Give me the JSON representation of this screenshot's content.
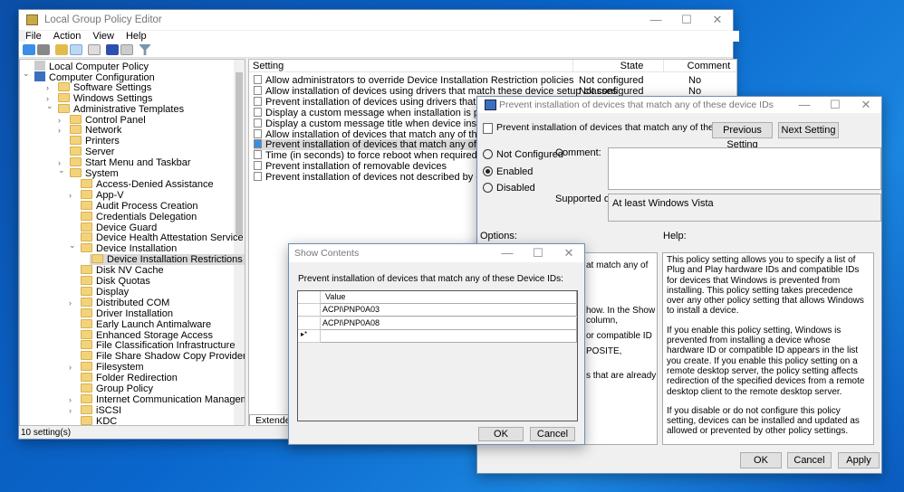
{
  "main": {
    "title": "Local Group Policy Editor",
    "menu": [
      "File",
      "Action",
      "View",
      "Help"
    ],
    "status": "10 setting(s)",
    "tab_extended": "Extended",
    "tree": [
      {
        "label": "Local Computer Policy",
        "level": 0,
        "chev": ""
      },
      {
        "label": "Computer Configuration",
        "level": 0.5,
        "chev": "v"
      },
      {
        "label": "Software Settings",
        "level": 1,
        "chev": ">"
      },
      {
        "label": "Windows Settings",
        "level": 1,
        "chev": ">"
      },
      {
        "label": "Administrative Templates",
        "level": 1,
        "chev": "v"
      },
      {
        "label": "Control Panel",
        "level": 2,
        "chev": ">"
      },
      {
        "label": "Network",
        "level": 2,
        "chev": ">"
      },
      {
        "label": "Printers",
        "level": 2,
        "chev": ""
      },
      {
        "label": "Server",
        "level": 2,
        "chev": ""
      },
      {
        "label": "Start Menu and Taskbar",
        "level": 2,
        "chev": ">"
      },
      {
        "label": "System",
        "level": 2,
        "chev": "v"
      },
      {
        "label": "Access-Denied Assistance",
        "level": 3,
        "chev": ""
      },
      {
        "label": "App-V",
        "level": 3,
        "chev": ">"
      },
      {
        "label": "Audit Process Creation",
        "level": 3,
        "chev": ""
      },
      {
        "label": "Credentials Delegation",
        "level": 3,
        "chev": ""
      },
      {
        "label": "Device Guard",
        "level": 3,
        "chev": ""
      },
      {
        "label": "Device Health Attestation Service",
        "level": 3,
        "chev": ""
      },
      {
        "label": "Device Installation",
        "level": 3,
        "chev": "v"
      },
      {
        "label": "Device Installation Restrictions",
        "level": 4,
        "chev": "",
        "selected": true
      },
      {
        "label": "Disk NV Cache",
        "level": 3,
        "chev": ""
      },
      {
        "label": "Disk Quotas",
        "level": 3,
        "chev": ""
      },
      {
        "label": "Display",
        "level": 3,
        "chev": ""
      },
      {
        "label": "Distributed COM",
        "level": 3,
        "chev": ">"
      },
      {
        "label": "Driver Installation",
        "level": 3,
        "chev": ""
      },
      {
        "label": "Early Launch Antimalware",
        "level": 3,
        "chev": ""
      },
      {
        "label": "Enhanced Storage Access",
        "level": 3,
        "chev": ""
      },
      {
        "label": "File Classification Infrastructure",
        "level": 3,
        "chev": ""
      },
      {
        "label": "File Share Shadow Copy Provider",
        "level": 3,
        "chev": ""
      },
      {
        "label": "Filesystem",
        "level": 3,
        "chev": ">"
      },
      {
        "label": "Folder Redirection",
        "level": 3,
        "chev": ""
      },
      {
        "label": "Group Policy",
        "level": 3,
        "chev": ""
      },
      {
        "label": "Internet Communication Management",
        "level": 3,
        "chev": ">"
      },
      {
        "label": "iSCSI",
        "level": 3,
        "chev": ">"
      },
      {
        "label": "KDC",
        "level": 3,
        "chev": ""
      }
    ],
    "columns": [
      "Setting",
      "State",
      "Comment"
    ],
    "settings": [
      {
        "name": "Allow administrators to override Device Installation Restriction policies",
        "state": "Not configured",
        "comment": "No"
      },
      {
        "name": "Allow installation of devices using drivers that match these device setup classes",
        "state": "Not configured",
        "comment": "No"
      },
      {
        "name": "Prevent installation of devices using drivers that match these device",
        "state": "",
        "comment": ""
      },
      {
        "name": "Display a custom message when installation is prevented by a policy",
        "state": "",
        "comment": ""
      },
      {
        "name": "Display a custom message title when device installation is prevented",
        "state": "",
        "comment": ""
      },
      {
        "name": "Allow installation of devices that match any of these device IDs",
        "state": "",
        "comment": ""
      },
      {
        "name": "Prevent installation of devices that match any of these device IDs",
        "state": "",
        "comment": "",
        "selected": true
      },
      {
        "name": "Time (in seconds) to force reboot when required for policy changes t",
        "state": "",
        "comment": ""
      },
      {
        "name": "Prevent installation of removable devices",
        "state": "",
        "comment": ""
      },
      {
        "name": "Prevent installation of devices not described by other policy settings",
        "state": "",
        "comment": ""
      }
    ]
  },
  "policy": {
    "title": "Prevent installation of devices that match any of these device IDs",
    "heading": "Prevent installation of devices that match any of these device IDs",
    "prev": "Previous Setting",
    "next": "Next Setting",
    "radios": [
      {
        "label": "Not Configured",
        "checked": false
      },
      {
        "label": "Enabled",
        "checked": true
      },
      {
        "label": "Disabled",
        "checked": false
      }
    ],
    "comment_label": "Comment:",
    "comment_value": "",
    "supported_label": "Supported on:",
    "supported_value": "At least Windows Vista",
    "options_label": "Options:",
    "help_label": "Help:",
    "options_fragments": [
      "at match any of",
      "how. In the Show",
      "column,",
      "or compatible ID",
      "POSITE,",
      "s that are already"
    ],
    "help": [
      "This policy setting allows you to specify a list of Plug and Play hardware IDs and compatible IDs for devices that Windows is prevented from installing. This policy setting takes precedence over any other policy setting that allows Windows to install a device.",
      "If you enable this policy setting, Windows is prevented from installing a device whose hardware ID or compatible ID appears in the list you create. If you enable this policy setting on a remote desktop server, the policy setting affects redirection of the specified devices from a remote desktop client to the remote desktop server.",
      "If you disable or do not configure this policy setting, devices can be installed and updated as allowed or prevented by other policy settings."
    ],
    "ok": "OK",
    "cancel": "Cancel",
    "apply": "Apply"
  },
  "show": {
    "title": "Show Contents",
    "prompt": "Prevent installation of devices that match any of these Device IDs:",
    "column": "Value",
    "values": [
      "ACPI\\PNP0A03",
      "ACPI\\PNP0A08"
    ],
    "new_row_marker": "▸*",
    "ok": "OK",
    "cancel": "Cancel"
  }
}
